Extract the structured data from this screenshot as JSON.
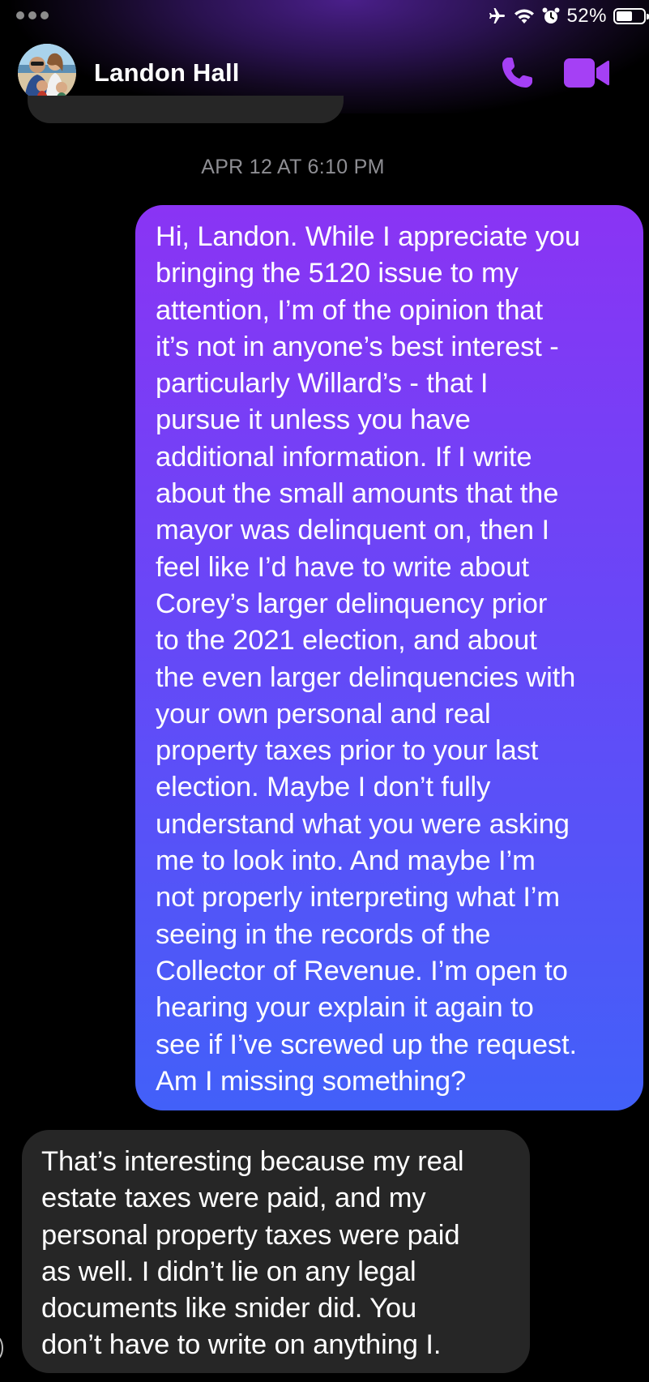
{
  "status_bar": {
    "battery_percent_text": "52%",
    "battery_level": 0.52,
    "icons": [
      "airplane-icon",
      "wifi-icon",
      "alarm-icon",
      "battery-icon"
    ]
  },
  "header": {
    "contact_name": "Landon Hall",
    "actions": [
      "phone-call-icon",
      "video-call-icon"
    ],
    "accent_color": "#a540f5"
  },
  "conversation": {
    "timestamp": "APR 12 AT 6:10 PM",
    "messages": [
      {
        "direction": "sent",
        "text": "Hi, Landon. While I appreciate you\nbringing the 5120 issue to my\nattention, I’m of the opinion that\nit’s not in anyone’s best interest -\nparticularly Willard’s - that I\npursue it unless you have\nadditional information. If I write\nabout the small amounts that the\nmayor was delinquent on, then I\nfeel like I’d have to write about\nCorey’s larger delinquency prior\nto the 2021 election, and about\nthe even larger delinquencies with\nyour own personal and real\nproperty taxes prior to your last\nelection. Maybe I don’t fully\nunderstand what you were asking\nme to look into. And maybe I’m\nnot properly interpreting what I’m\nseeing in the records of the\nCollector of Revenue. I’m open to\nhearing your explain it again to\nsee if I’ve screwed up the request.\nAm I missing something?"
      },
      {
        "direction": "received",
        "text": "That’s interesting because my real\nestate taxes were paid, and my\npersonal property taxes were paid\nas well. I didn’t lie on any legal\ndocuments like snider did. You\ndon’t have to write on anything I."
      }
    ]
  },
  "colors": {
    "background": "#000000",
    "sent_gradient_top": "#8a34f4",
    "sent_gradient_bottom": "#4260f9",
    "received_bubble": "#262626",
    "timestamp_text": "#8e8e93"
  }
}
